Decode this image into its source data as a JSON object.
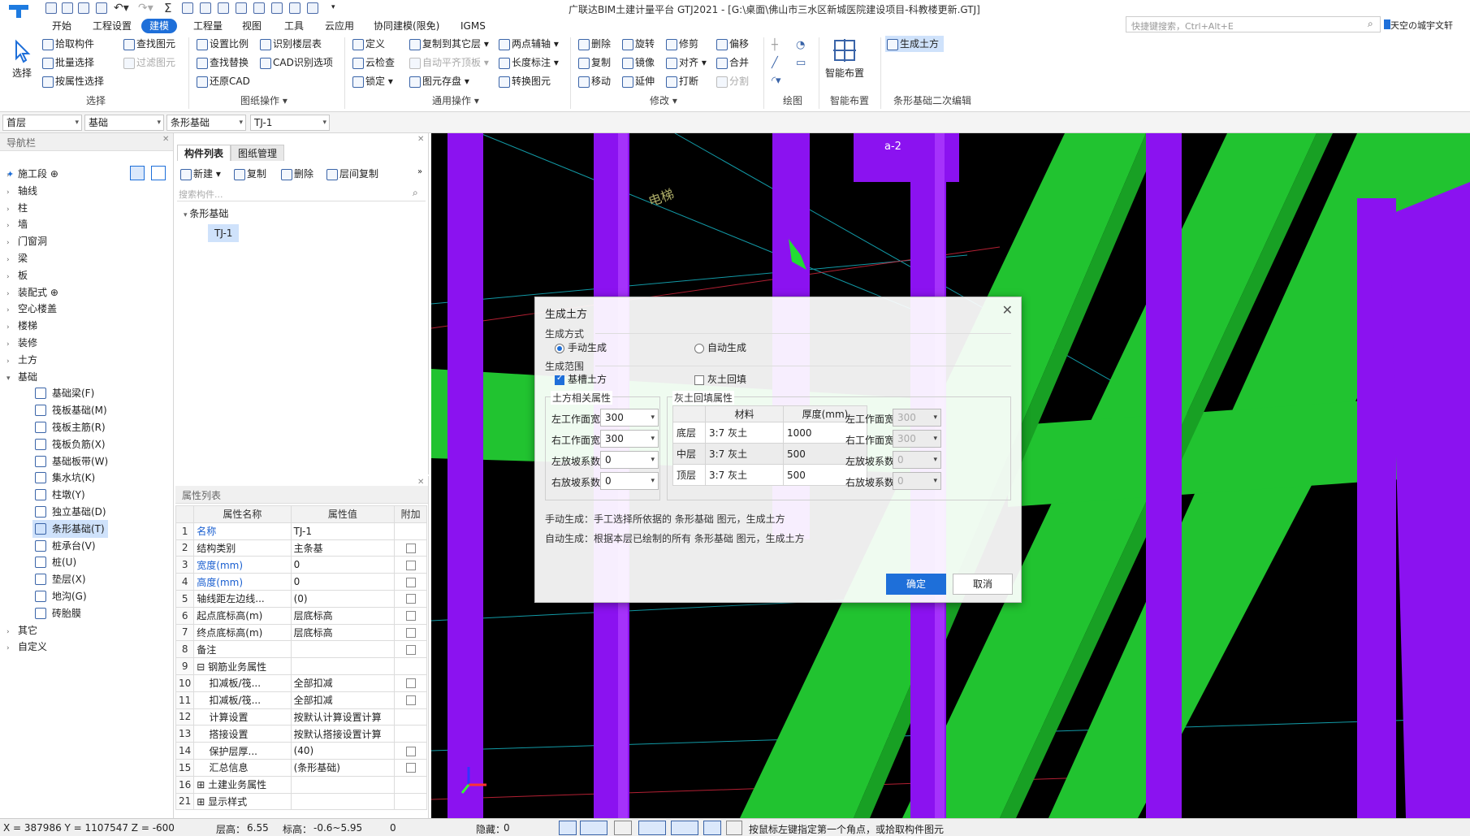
{
  "window": {
    "title": "广联达BIM土建计量平台 GTJ2021 - [G:\\桌面\\佛山市三水区新城医院建设项目-科教楼更新.GTJ]"
  },
  "menu": {
    "items": [
      "开始",
      "工程设置",
      "建模",
      "工程量",
      "视图",
      "工具",
      "云应用",
      "协同建模(限免)",
      "IGMS"
    ],
    "active": "建模"
  },
  "search": {
    "placeholder": "快捷键搜索，Ctrl+Alt+E"
  },
  "user": {
    "name": "天空の城宇文轩"
  },
  "ribbon": {
    "select": {
      "big": "选择",
      "items": [
        "拾取构件",
        "批量选择",
        "按属性选择",
        "查找图元",
        "过滤图元"
      ],
      "group": "选择"
    },
    "drawing": {
      "items": [
        "设置比例",
        "查找替换",
        "还原CAD",
        "识别楼层表",
        "CAD识别选项"
      ],
      "group": "图纸操作 ▾"
    },
    "common": {
      "items": [
        "定义",
        "云检查",
        "锁定 ▾",
        "复制到其它层 ▾",
        "自动平齐顶板 ▾",
        "图元存盘 ▾",
        "两点辅轴 ▾",
        "长度标注 ▾",
        "转换图元"
      ],
      "group": "通用操作 ▾"
    },
    "modify": {
      "items": [
        "删除",
        "复制",
        "移动",
        "旋转",
        "镜像",
        "延伸",
        "修剪",
        "对齐 ▾",
        "打断",
        "偏移",
        "合并",
        "分割"
      ],
      "group": "修改 ▾"
    },
    "draw": {
      "group": "绘图"
    },
    "smart": {
      "big": "智能布置",
      "group": "智能布置"
    },
    "strip": {
      "items": [
        "生成土方"
      ],
      "group": "条形基础二次编辑"
    }
  },
  "layer_bar": {
    "floor": "首层",
    "category": "基础",
    "type": "条形基础",
    "component": "TJ-1"
  },
  "nav": {
    "title": "导航栏",
    "items": [
      "施工段 ⊕",
      "轴线",
      "柱",
      "墙",
      "门窗洞",
      "梁",
      "板",
      "装配式 ⊕",
      "空心楼盖",
      "楼梯",
      "装修",
      "土方",
      "基础"
    ],
    "sub": [
      "基础梁(F)",
      "筏板基础(M)",
      "筏板主筋(R)",
      "筏板负筋(X)",
      "基础板带(W)",
      "集水坑(K)",
      "柱墩(Y)",
      "独立基础(D)",
      "条形基础(T)",
      "桩承台(V)",
      "桩(U)",
      "垫层(X)",
      "地沟(G)",
      "砖胎膜"
    ],
    "tail": [
      "其它",
      "自定义"
    ],
    "selected": "条形基础(T)"
  },
  "component_list": {
    "tabs": [
      "构件列表",
      "图纸管理"
    ],
    "toolbar": [
      "新建 ▾",
      "复制",
      "删除",
      "层间复制"
    ],
    "search_placeholder": "搜索构件...",
    "tree_parent": "条形基础",
    "tree_child": "TJ-1"
  },
  "property_list": {
    "title": "属性列表",
    "headers": [
      "属性名称",
      "属性值",
      "附加"
    ],
    "rows": [
      {
        "n": "1",
        "name": "名称",
        "value": "TJ-1",
        "blue": true,
        "cb": false
      },
      {
        "n": "2",
        "name": "结构类别",
        "value": "主条基",
        "blue": false,
        "cb": true
      },
      {
        "n": "3",
        "name": "宽度(mm)",
        "value": "0",
        "blue": true,
        "cb": true
      },
      {
        "n": "4",
        "name": "高度(mm)",
        "value": "0",
        "blue": true,
        "cb": true
      },
      {
        "n": "5",
        "name": "轴线距左边线...",
        "value": "(0)",
        "blue": false,
        "cb": true
      },
      {
        "n": "6",
        "name": "起点底标高(m)",
        "value": "层底标高",
        "blue": false,
        "cb": true
      },
      {
        "n": "7",
        "name": "终点底标高(m)",
        "value": "层底标高",
        "blue": false,
        "cb": true
      },
      {
        "n": "8",
        "name": "备注",
        "value": "",
        "blue": false,
        "cb": true
      },
      {
        "n": "9",
        "name": "⊟ 钢筋业务属性",
        "value": "",
        "blue": false,
        "cb": false
      },
      {
        "n": "10",
        "name": "    扣减板/筏...",
        "value": "全部扣减",
        "blue": false,
        "cb": true
      },
      {
        "n": "11",
        "name": "    扣减板/筏...",
        "value": "全部扣减",
        "blue": false,
        "cb": true
      },
      {
        "n": "12",
        "name": "    计算设置",
        "value": "按默认计算设置计算",
        "blue": false,
        "cb": false
      },
      {
        "n": "13",
        "name": "    搭接设置",
        "value": "按默认搭接设置计算",
        "blue": false,
        "cb": false
      },
      {
        "n": "14",
        "name": "    保护层厚...",
        "value": "(40)",
        "blue": false,
        "cb": true
      },
      {
        "n": "15",
        "name": "    汇总信息",
        "value": "(条形基础)",
        "blue": false,
        "cb": true
      },
      {
        "n": "16",
        "name": "⊞ 土建业务属性",
        "value": "",
        "blue": false,
        "cb": false
      },
      {
        "n": "21",
        "name": "⊞ 显示样式",
        "value": "",
        "blue": false,
        "cb": false
      }
    ]
  },
  "viewport": {
    "labels": [
      "a-2",
      "电梯"
    ],
    "colors": {
      "purple": "#8b12f0",
      "green": "#21c330"
    }
  },
  "dialog": {
    "title": "生成土方",
    "method_label": "生成方式",
    "manual": "手动生成",
    "auto": "自动生成",
    "scope_label": "生成范围",
    "trench": "基槽土方",
    "backfill": "灰土回填",
    "earth_group": "土方相关属性",
    "backfill_group": "灰土回填属性",
    "fields": {
      "left_width": "左工作面宽",
      "right_width": "右工作面宽",
      "left_slope": "左放坡系数",
      "right_slope": "右放坡系数"
    },
    "values": {
      "left_width": "300",
      "right_width": "300",
      "left_slope": "0",
      "right_slope": "0"
    },
    "backfill_values": {
      "left_width": "300",
      "right_width": "300",
      "left_slope": "0",
      "right_slope": "0"
    },
    "table": {
      "headers": [
        "材料",
        "厚度(mm)"
      ],
      "rows": [
        [
          "底层",
          "3:7 灰土",
          "1000"
        ],
        [
          "中层",
          "3:7 灰土",
          "500"
        ],
        [
          "顶层",
          "3:7 灰土",
          "500"
        ]
      ]
    },
    "note1": "手动生成：手工选择所依据的 条形基础 图元，生成土方",
    "note2": "自动生成：根据本层已绘制的所有 条形基础 图元，生成土方",
    "ok": "确定",
    "cancel": "取消"
  },
  "status": {
    "coords": "X = 387986 Y = 1107547 Z = -600",
    "floor_height_label": "层高：",
    "floor_height": "6.55",
    "elev_label": "标高：",
    "elev": "-0.6~5.95",
    "count": "0",
    "hidden_label": "隐藏：",
    "hidden": "0",
    "hint": "按鼠标左键指定第一个角点，或拾取构件图元"
  }
}
